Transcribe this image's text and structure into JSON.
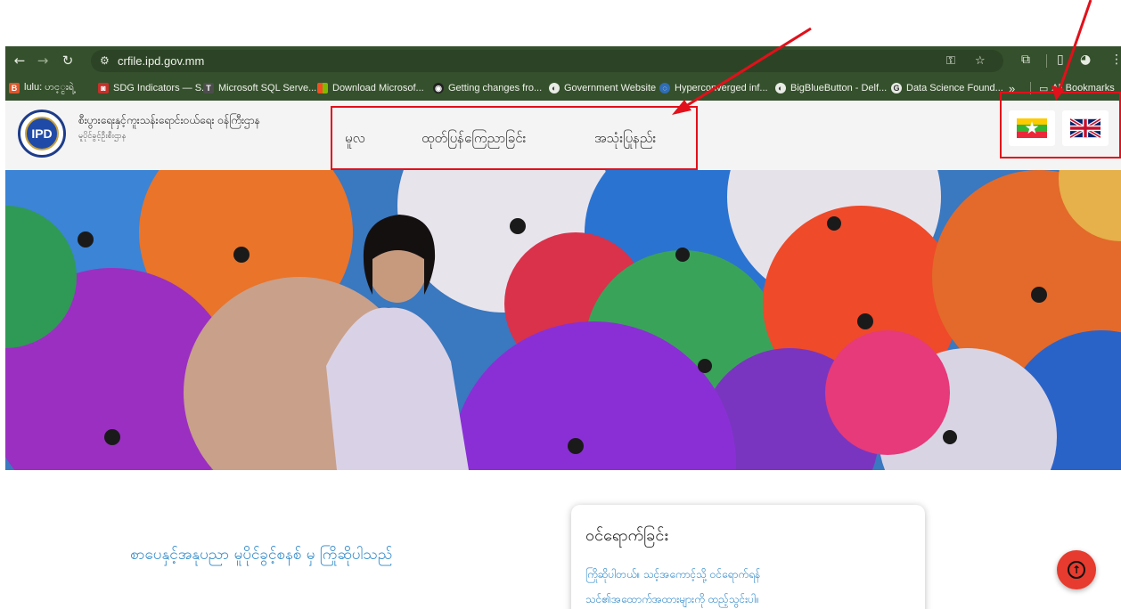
{
  "browser": {
    "url": "crfile.ipd.gov.mm",
    "bookmarks": [
      {
        "label": "lulu: ဟင့္ငးရဲ့",
        "color": "#e0562b",
        "icon": "B"
      },
      {
        "label": "SDG Indicators — S...",
        "color": "#c8302a",
        "icon": "◙"
      },
      {
        "label": "Microsoft SQL Serve...",
        "color": "#4d4d4d",
        "icon": "T"
      },
      {
        "label": "Download Microsof...",
        "color": "#f25022",
        "icon": "▦"
      },
      {
        "label": "Getting changes fro...",
        "color": "#222222",
        "icon": "◉"
      },
      {
        "label": "Government Website",
        "color": "#444444",
        "icon": "◐"
      },
      {
        "label": "Hyperconverged inf...",
        "color": "#2f6db5",
        "icon": "◌"
      },
      {
        "label": "BigBlueButton - Delf...",
        "color": "#444444",
        "icon": "◐"
      },
      {
        "label": "Data Science Found...",
        "color": "#444444",
        "icon": "G"
      }
    ],
    "more_label": "»",
    "all_bookmarks_label": "All Bookmarks"
  },
  "header": {
    "logo_text": "IPD",
    "org_name": "စီးပွားရေးနှင့်ကူးသန်းရောင်းဝယ်ရေး ဝန်ကြီးဌာန",
    "org_sub": "မူပိုင်ခွင့်ဦးစီးဌာန",
    "menu": [
      {
        "label": "မူလ"
      },
      {
        "label": "ထုတ်ပြန်ကြေညာခြင်း"
      },
      {
        "label": "အသုံးပြုနည်း"
      }
    ]
  },
  "content": {
    "welcome": "စာပေနှင့်အနုပညာ မူပိုင်ခွင့်စနစ် မှ ကြိုဆိုပါသည်",
    "login_title": "ဝင်ရောက်ခြင်း",
    "login_line1": "ကြိုဆိုပါတယ်။ သင့်အကောင့်သို့ ဝင်ရောက်ရန်",
    "login_line2": "သင်၏အထောက်အထားများကို ထည့်သွင်းပါ။"
  },
  "colors": {
    "browser_bar": "#35502c",
    "annotation": "#e2101a",
    "accent": "#2f88c8",
    "fab": "#e63b2e"
  }
}
